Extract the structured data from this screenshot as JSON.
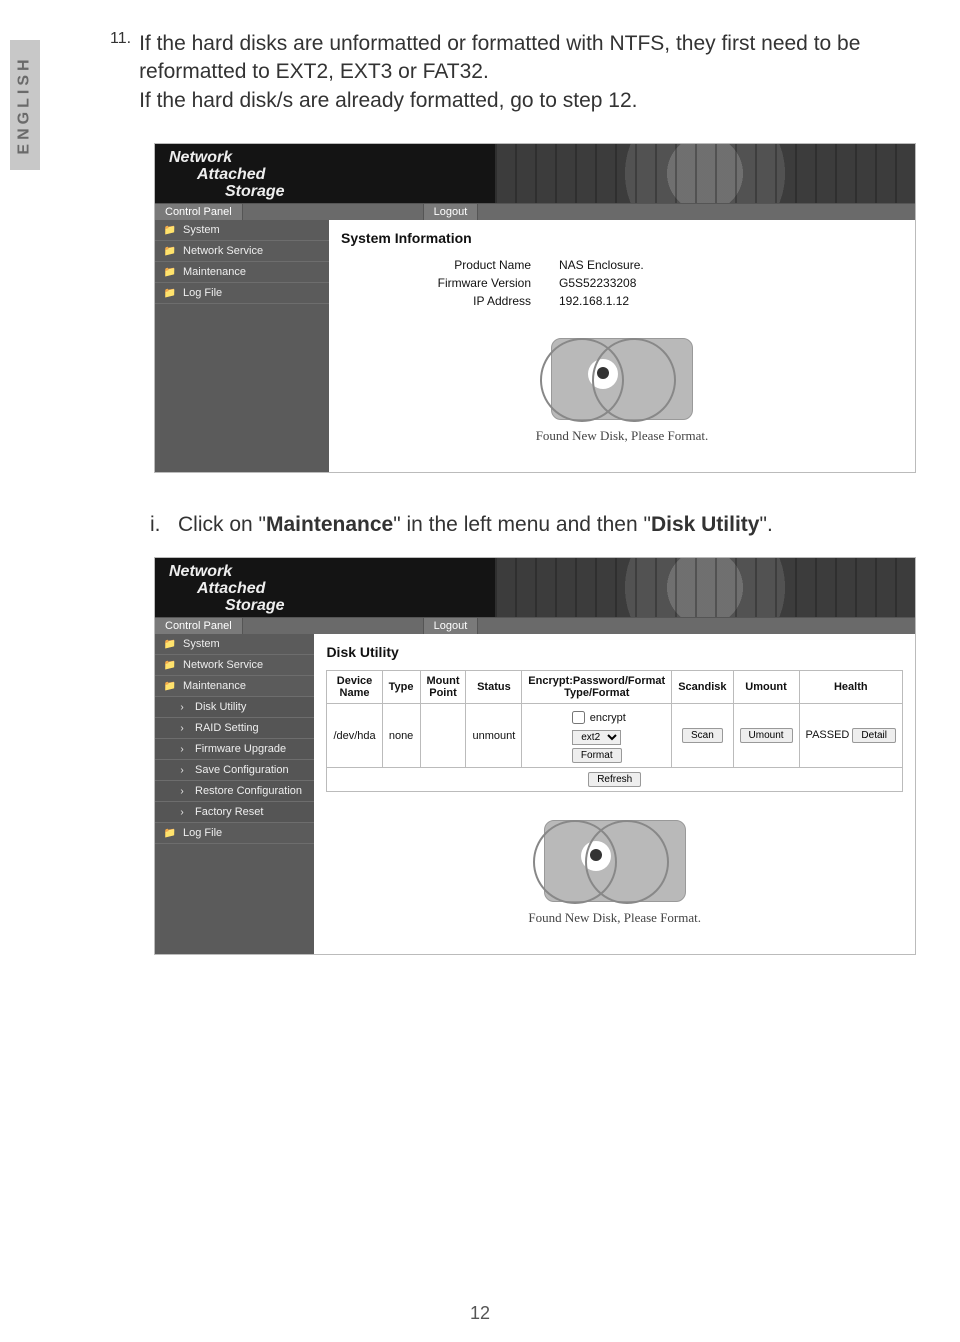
{
  "side_tab": "ENGLISH",
  "step": {
    "num": "11.",
    "text1": "If the hard disks are unformatted or formatted with NTFS, they first need to be reformatted to EXT2, EXT3 or FAT32.",
    "text2": "If the hard disk/s are already formatted, go to step 12."
  },
  "sub_step": {
    "num": "i.",
    "text": "Click on \"Maintenance\" in the left menu and then \"Disk Utility\"."
  },
  "page_number": "12",
  "screenshot1": {
    "brand": {
      "l1": "Network",
      "l2": "Attached",
      "l3": "Storage"
    },
    "tabs": {
      "control_panel": "Control Panel",
      "logout": "Logout"
    },
    "sidebar": [
      {
        "label": "System",
        "kind": "top"
      },
      {
        "label": "Network Service",
        "kind": "top"
      },
      {
        "label": "Maintenance",
        "kind": "top"
      },
      {
        "label": "Log File",
        "kind": "top"
      }
    ],
    "heading": "System Information",
    "rows": [
      {
        "k": "Product Name",
        "v": "NAS Enclosure."
      },
      {
        "k": "Firmware Version",
        "v": "G5S52233208"
      },
      {
        "k": "IP Address",
        "v": "192.168.1.12"
      }
    ],
    "caption": "Found New Disk, Please Format."
  },
  "screenshot2": {
    "brand": {
      "l1": "Network",
      "l2": "Attached",
      "l3": "Storage"
    },
    "tabs": {
      "control_panel": "Control Panel",
      "logout": "Logout"
    },
    "sidebar": [
      {
        "label": "System",
        "kind": "top"
      },
      {
        "label": "Network Service",
        "kind": "top"
      },
      {
        "label": "Maintenance",
        "kind": "top"
      },
      {
        "label": "Disk Utility",
        "kind": "sub"
      },
      {
        "label": "RAID Setting",
        "kind": "sub"
      },
      {
        "label": "Firmware Upgrade",
        "kind": "sub"
      },
      {
        "label": "Save Configuration",
        "kind": "sub"
      },
      {
        "label": "Restore Configuration",
        "kind": "sub"
      },
      {
        "label": "Factory Reset",
        "kind": "sub"
      },
      {
        "label": "Log File",
        "kind": "top"
      }
    ],
    "heading": "Disk Utility",
    "table": {
      "headers": [
        "Device Name",
        "Type",
        "Mount Point",
        "Status",
        "Encrypt:Password/Format Type/Format",
        "Scandisk",
        "Umount",
        "Health"
      ],
      "row": {
        "device": "/dev/hda",
        "type": "none",
        "mount": "",
        "status": "unmount",
        "encrypt_label": "encrypt",
        "format_select": "ext2",
        "format_btn": "Format",
        "scan_btn": "Scan",
        "umount_btn": "Umount",
        "health": "PASSED",
        "detail_btn": "Detail"
      },
      "refresh_btn": "Refresh"
    },
    "caption": "Found New Disk, Please Format."
  }
}
